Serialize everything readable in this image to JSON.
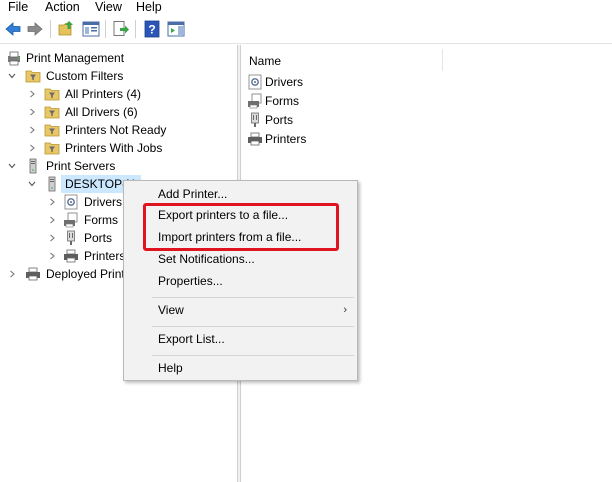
{
  "menu": [
    "File",
    "Action",
    "View",
    "Help"
  ],
  "tree": {
    "root": "Print Management",
    "custom_filters": "Custom Filters",
    "all_printers": "All Printers (4)",
    "all_drivers": "All Drivers (6)",
    "not_ready": "Printers Not Ready",
    "with_jobs": "Printers With Jobs",
    "print_servers": "Print Servers",
    "server": "DESKTOP-N",
    "drivers": "Drivers",
    "forms": "Forms",
    "ports": "Ports",
    "printers": "Printers",
    "deployed": "Deployed Print"
  },
  "list": {
    "column_name": "Name",
    "items": [
      "Drivers",
      "Forms",
      "Ports",
      "Printers"
    ]
  },
  "context_menu": {
    "add_printer": "Add Printer...",
    "export": "Export printers to a file...",
    "import": "Import printers from a file...",
    "notifications": "Set Notifications...",
    "properties": "Properties...",
    "view": "View",
    "view_arrow": "›",
    "export_list": "Export List...",
    "help": "Help"
  },
  "colors": {
    "highlight_box": "#e0141f",
    "selection": "#cce8ff",
    "menu_bg": "#f2f2f2"
  }
}
